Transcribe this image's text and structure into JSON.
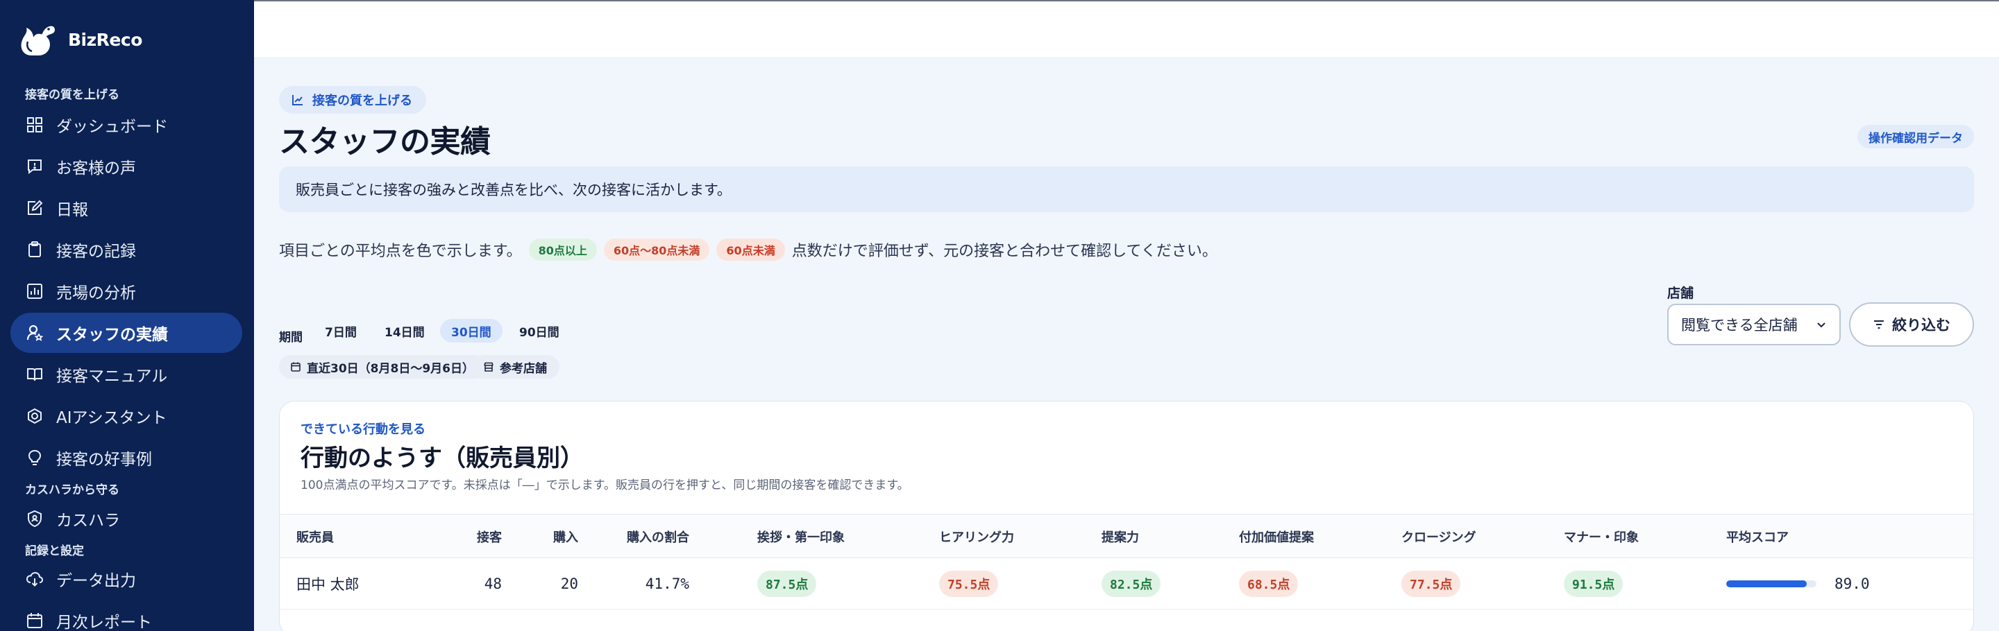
{
  "sidebar": {
    "brand": "BizReco",
    "sections": {
      "improve": "接客の質を上げる",
      "protect": "カスハラから守る",
      "records": "記録と設定"
    },
    "items": [
      {
        "label": "ダッシュボード",
        "icon": "dashboard-icon"
      },
      {
        "label": "お客様の声",
        "icon": "message-icon"
      },
      {
        "label": "日報",
        "icon": "edit-icon"
      },
      {
        "label": "接客の記録",
        "icon": "clipboard-icon"
      },
      {
        "label": "売場の分析",
        "icon": "chart-icon"
      },
      {
        "label": "スタッフの実績",
        "icon": "user-star-icon"
      },
      {
        "label": "接客マニュアル",
        "icon": "book-icon"
      },
      {
        "label": "AIアシスタント",
        "icon": "robot-icon"
      },
      {
        "label": "接客の好事例",
        "icon": "lightbulb-icon"
      },
      {
        "label": "カスハラ",
        "icon": "shield-icon"
      },
      {
        "label": "データ出力",
        "icon": "download-cloud-icon"
      },
      {
        "label": "月次レポート",
        "icon": "calendar-icon"
      }
    ],
    "active_index": 5
  },
  "page": {
    "crumb": "接客の質を上げる",
    "title": "スタッフの実績",
    "demo_badge": "操作確認用データ",
    "banner": "販売員ごとに接客の強みと改善点を比べ、次の接客に活かします。",
    "legend": {
      "intro": "項目ごとの平均点を色で示します。",
      "good": "80点以上",
      "mid": "60点〜80点未満",
      "low": "60点未満",
      "outro": "点数だけで評価せず、元の接客と合わせて確認してください。"
    }
  },
  "filters": {
    "period_label": "期間",
    "periods": [
      "7日間",
      "14日間",
      "30日間",
      "90日間"
    ],
    "active_period": "30日間",
    "date_range": "直近30日（8月8日〜9月6日）",
    "reference_store": "参考店舗",
    "store_label": "店舗",
    "store_value": "閲覧できる全店舗",
    "filter_button": "絞り込む"
  },
  "colors": {
    "sidebar_bg": "#0b2252",
    "accent": "#2563e0",
    "good": "#1d7a3d",
    "mid": "#c2402a"
  },
  "card": {
    "eyebrow": "できている行動を見る",
    "title": "行動のようす（販売員別）",
    "description": "100点満点の平均スコアです。未採点は「―」で示します。販売員の行を押すと、同じ期間の接客を確認できます。",
    "columns": [
      "販売員",
      "接客",
      "購入",
      "購入の割合",
      "挨拶・第一印象",
      "ヒアリング力",
      "提案力",
      "付加価値提案",
      "クロージング",
      "マナー・印象",
      "平均スコア"
    ],
    "rows": [
      {
        "name": "田中 太郎",
        "visits": "48",
        "purchases": "20",
        "rate": "41.7%",
        "scores": [
          {
            "text": "87.5点",
            "level": "good"
          },
          {
            "text": "75.5点",
            "level": "mid"
          },
          {
            "text": "82.5点",
            "level": "good"
          },
          {
            "text": "68.5点",
            "level": "mid"
          },
          {
            "text": "77.5点",
            "level": "mid"
          },
          {
            "text": "91.5点",
            "level": "good"
          }
        ],
        "average": "89.0",
        "average_fraction": 0.89
      }
    ]
  }
}
